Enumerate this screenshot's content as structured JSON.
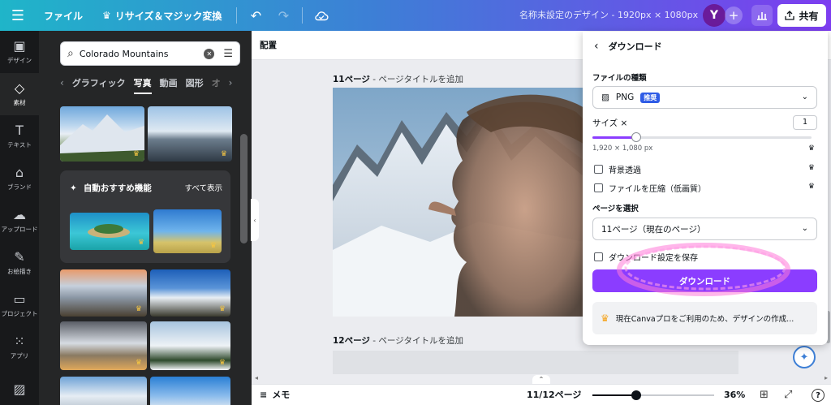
{
  "topbar": {
    "menu_icon": "hamburger-icon",
    "file_label": "ファイル",
    "resize_label": "リサイズ＆マジック変換",
    "doc_title": "名称未設定のデザイン - 1920px × 1080px",
    "avatar_initial": "Y",
    "share_label": "共有"
  },
  "rail": {
    "items": [
      {
        "label": "デザイン",
        "icon": "layout-icon"
      },
      {
        "label": "素材",
        "icon": "elements-icon"
      },
      {
        "label": "テキスト",
        "icon": "text-icon"
      },
      {
        "label": "ブランド",
        "icon": "brand-icon"
      },
      {
        "label": "アップロード",
        "icon": "upload-icon"
      },
      {
        "label": "お絵描き",
        "icon": "draw-icon"
      },
      {
        "label": "プロジェクト",
        "icon": "folder-icon"
      },
      {
        "label": "アプリ",
        "icon": "apps-icon"
      }
    ],
    "active_index": 1
  },
  "panel": {
    "search_value": "Colorado Mountains",
    "tabs": [
      "グラフィック",
      "写真",
      "動画",
      "図形",
      "オ"
    ],
    "active_tab": "写真",
    "recommend_title": "自動おすすめ機能",
    "recommend_all": "すべて表示"
  },
  "editor": {
    "position_label": "配置",
    "page11_num": "11ページ",
    "page11_hint": " - ページタイトルを追加",
    "page12_num": "12ページ",
    "page12_hint": " - ページタイトルを追加"
  },
  "bottombar": {
    "memo_label": "メモ",
    "page_indicator": "11/12ページ",
    "zoom_level": 0.36,
    "zoom_label": "36%",
    "help_label": "?"
  },
  "download_panel": {
    "title": "ダウンロード",
    "file_type_label": "ファイルの種類",
    "file_type_value": "PNG",
    "file_type_badge": "推奨",
    "size_label": "サイズ ×",
    "size_value": "1",
    "size_slider_level": 0.2,
    "size_dimensions": "1,920 × 1,080 px",
    "transparent_bg_label": "背景透過",
    "compress_label": "ファイルを圧縮（低画質）",
    "select_pages_label": "ページを選択",
    "pages_value": "11ページ（現在のページ）",
    "save_settings_label": "ダウンロード設定を保存",
    "download_button": "ダウンロード",
    "pro_note": "現在Canvaプロをご利用のため、デザインの作成..."
  },
  "colors": {
    "accent": "#8b3dff",
    "topbar_start": "#1fb5c9",
    "topbar_end": "#7d3df0",
    "rail_bg": "#18191b",
    "panel_bg": "#252627",
    "badge": "#2f5ce6"
  }
}
